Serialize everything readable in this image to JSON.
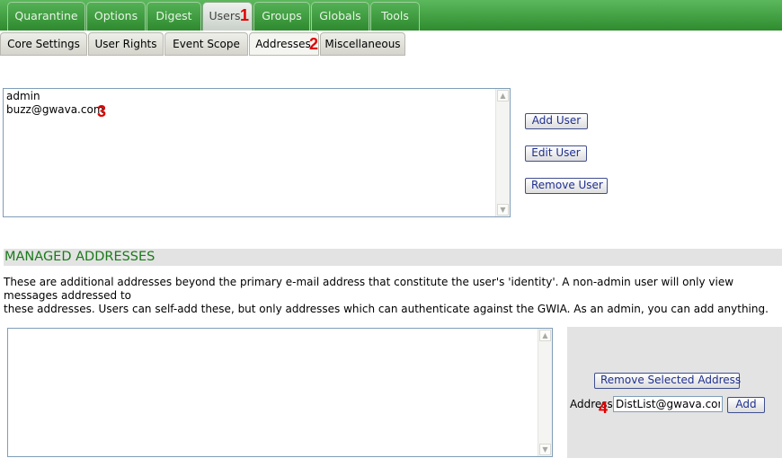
{
  "top_tabs": [
    {
      "label": "Quarantine"
    },
    {
      "label": "Options"
    },
    {
      "label": "Digest"
    },
    {
      "label": "Users",
      "active": true
    },
    {
      "label": "Groups"
    },
    {
      "label": "Globals"
    },
    {
      "label": "Tools"
    }
  ],
  "sub_tabs": [
    {
      "label": "Core Settings"
    },
    {
      "label": "User Rights"
    },
    {
      "label": "Event Scope"
    },
    {
      "label": "Addresses",
      "active": true
    },
    {
      "label": "Miscellaneous"
    }
  ],
  "markers": {
    "m1": "1",
    "m2": "2",
    "m3": "3",
    "m4": "4"
  },
  "users_list": {
    "items": [
      "admin",
      "buzz@gwava.com"
    ]
  },
  "user_buttons": {
    "add": "Add User",
    "edit": "Edit User",
    "remove": "Remove User"
  },
  "managed": {
    "title": "MANAGED ADDRESSES",
    "description_line1": "These are additional addresses beyond the primary e-mail address that constitute the user's 'identity'. A non-admin user will only view messages addressed to",
    "description_line2": "these addresses. Users can self-add these, but only addresses which can authenticate against the GWIA. As an admin, you can add anything.",
    "remove_button": "Remove Selected Address",
    "address_label": "Address",
    "address_value": "DistList@gwava.com",
    "add_button": "Add"
  },
  "colors": {
    "tab_green": "#2e8b2e",
    "title_green": "#1a7a1a",
    "marker_red": "#e00000",
    "button_text": "#1f2f8f"
  },
  "icons": {
    "scroll_up": "scroll-up-arrow-icon",
    "scroll_down": "scroll-down-arrow-icon"
  }
}
